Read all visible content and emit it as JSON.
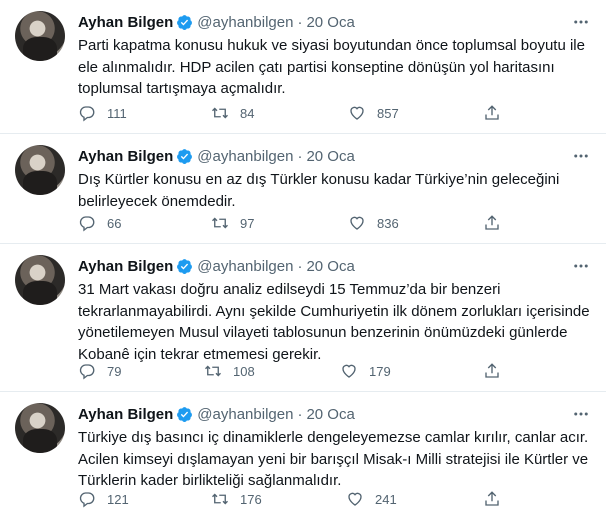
{
  "tweets": [
    {
      "name": "Ayhan Bilgen",
      "handle": "@ayhanbilgen",
      "separator": "·",
      "date": "20 Oca",
      "text": "Parti kapatma konusu hukuk ve siyasi boyutundan önce toplumsal boyutu ile ele alınmalıdır. HDP acilen çatı partisi konseptine dönüşün yol haritasını toplumsal tartışmaya açmalıdır.",
      "replies": "111",
      "retweets": "84",
      "likes": "857"
    },
    {
      "name": "Ayhan Bilgen",
      "handle": "@ayhanbilgen",
      "separator": "·",
      "date": "20 Oca",
      "text": "Dış Kürtler konusu en az dış Türkler konusu kadar Türkiye’nin geleceğini belirleyecek önemdedir.",
      "replies": "66",
      "retweets": "97",
      "likes": "836"
    },
    {
      "name": "Ayhan Bilgen",
      "handle": "@ayhanbilgen",
      "separator": "·",
      "date": "20 Oca",
      "text": "31 Mart vakası doğru analiz edilseydi 15 Temmuz’da bir benzeri tekrarlanmayabilirdi. Aynı şekilde Cumhuriyetin ilk dönem zorlukları içerisinde yönetilemeyen Musul vilayeti tablosunun benzerinin önümüzdeki günlerde Kobanê için tekrar etmemesi gerekir.",
      "replies": "79",
      "retweets": "108",
      "likes": "179"
    },
    {
      "name": "Ayhan Bilgen",
      "handle": "@ayhanbilgen",
      "separator": "·",
      "date": "20 Oca",
      "text": "Türkiye dış basıncı iç dinamiklerle dengeleyemezse camlar kırılır, canlar acır. Acilen kimseyi dışlamayan yeni bir barışçıl Misak-ı Milli stratejisi ile Kürtler ve Türklerin kader birlikteliği sağlanmalıdır.",
      "replies": "121",
      "retweets": "176",
      "likes": "241"
    }
  ],
  "colors": {
    "text": "#0f1419",
    "secondary": "#536471",
    "verified": "#1d9bf0",
    "divider": "#e6ecf0"
  },
  "icons": [
    "verified-badge-icon",
    "more-options-icon",
    "reply-icon",
    "retweet-icon",
    "like-icon",
    "share-icon"
  ]
}
